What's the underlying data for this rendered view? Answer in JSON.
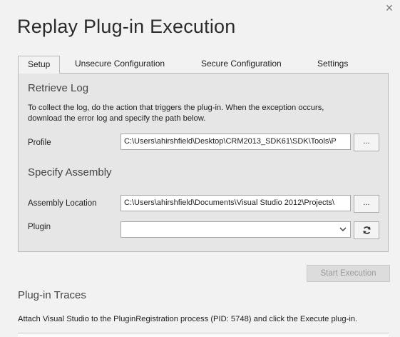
{
  "window": {
    "title": "Replay Plug-in Execution",
    "close_icon": "close-icon"
  },
  "tabs": [
    {
      "label": "Setup",
      "active": true
    },
    {
      "label": "Unsecure Configuration",
      "active": false
    },
    {
      "label": "Secure Configuration",
      "active": false
    },
    {
      "label": "Settings",
      "active": false
    }
  ],
  "retrieve_log": {
    "heading": "Retrieve Log",
    "description_line1": "To collect the log, do the action that triggers the plug-in. When the exception occurs,",
    "description_line2": "download the error log and specify the path below.",
    "profile_label": "Profile",
    "profile_value": "C:\\Users\\ahirshfield\\Desktop\\CRM2013_SDK61\\SDK\\Tools\\P",
    "browse_label": "..."
  },
  "specify_assembly": {
    "heading": "Specify Assembly",
    "assembly_label": "Assembly Location",
    "assembly_value": "C:\\Users\\ahirshfield\\Documents\\Visual Studio 2012\\Projects\\",
    "browse_label": "...",
    "plugin_label": "Plugin",
    "plugin_value": "",
    "refresh_icon": "refresh-icon"
  },
  "actions": {
    "start_label": "Start Execution",
    "start_enabled": false
  },
  "traces": {
    "heading": "Plug-in Traces",
    "text": "Attach Visual Studio to the PluginRegistration process (PID: 5748) and click the Execute plug-in."
  }
}
